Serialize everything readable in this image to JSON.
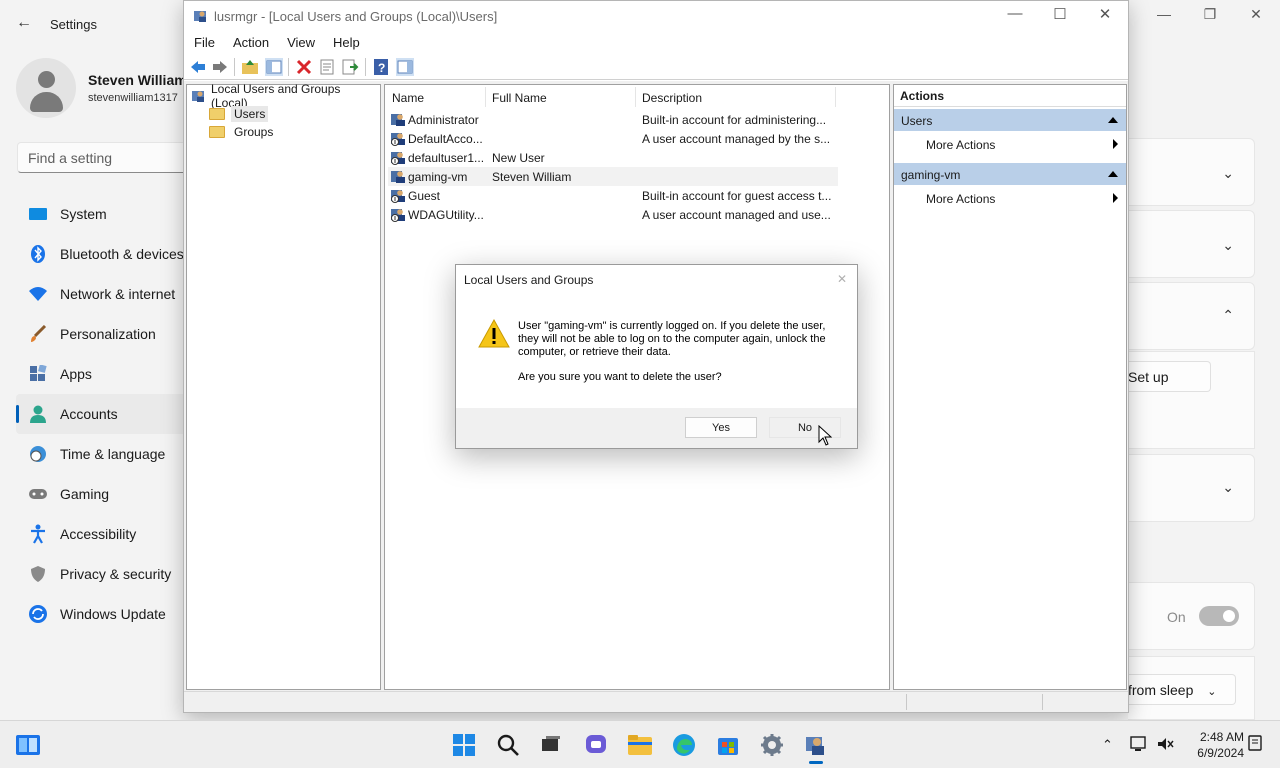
{
  "settings": {
    "title": "Settings",
    "user_name": "Steven William",
    "user_email": "stevenwilliam1317",
    "search_placeholder": "Find a setting",
    "nav": [
      {
        "label": "System",
        "icon": "system-icon"
      },
      {
        "label": "Bluetooth & devices",
        "icon": "bluetooth-icon"
      },
      {
        "label": "Network & internet",
        "icon": "network-icon"
      },
      {
        "label": "Personalization",
        "icon": "brush-icon"
      },
      {
        "label": "Apps",
        "icon": "apps-icon"
      },
      {
        "label": "Accounts",
        "icon": "accounts-icon",
        "active": true
      },
      {
        "label": "Time & language",
        "icon": "clock-globe-icon"
      },
      {
        "label": "Gaming",
        "icon": "gamepad-icon"
      },
      {
        "label": "Accessibility",
        "icon": "accessibility-icon"
      },
      {
        "label": "Privacy & security",
        "icon": "shield-icon"
      },
      {
        "label": "Windows Update",
        "icon": "update-icon"
      }
    ],
    "setup_label": "Set up",
    "toggle_label": "On",
    "sleep_label": "from sleep"
  },
  "mmc": {
    "title": "lusrmgr - [Local Users and Groups (Local)\\Users]",
    "menu": [
      "File",
      "Action",
      "View",
      "Help"
    ],
    "tree": {
      "root": "Local Users and Groups (Local)",
      "children": [
        "Users",
        "Groups"
      ]
    },
    "columns": [
      "Name",
      "Full Name",
      "Description"
    ],
    "rows": [
      {
        "name": "Administrator",
        "full_name": "",
        "description": "Built-in account for administering..."
      },
      {
        "name": "DefaultAcco...",
        "full_name": "",
        "description": "A user account managed by the s..."
      },
      {
        "name": "defaultuser1...",
        "full_name": "New User",
        "description": ""
      },
      {
        "name": "gaming-vm",
        "full_name": "Steven William",
        "description": ""
      },
      {
        "name": "Guest",
        "full_name": "",
        "description": "Built-in account for guest access t..."
      },
      {
        "name": "WDAGUtility...",
        "full_name": "",
        "description": "A user account managed and use..."
      }
    ],
    "actions": {
      "header": "Actions",
      "sections": [
        {
          "title": "Users",
          "item": "More Actions"
        },
        {
          "title": "gaming-vm",
          "item": "More Actions"
        }
      ]
    }
  },
  "dialog": {
    "title": "Local Users and Groups",
    "message": "User \"gaming-vm\" is currently logged on. If you delete the user, they will not be able to log on to the computer again, unlock the computer, or retrieve their data.",
    "question": "Are you sure you want to delete the user?",
    "yes_label": "Yes",
    "no_label": "No"
  },
  "taskbar": {
    "time": "2:48 AM",
    "date": "6/9/2024",
    "apps": [
      "start-icon",
      "search-icon",
      "task-view-icon",
      "chat-icon",
      "file-explorer-icon",
      "edge-icon",
      "store-icon",
      "settings-gear-icon",
      "lusrmgr-icon"
    ]
  },
  "colors": {
    "accent": "#005fb8",
    "actions_section_bg": "#b9cfe8",
    "warning": "#f5c518"
  }
}
